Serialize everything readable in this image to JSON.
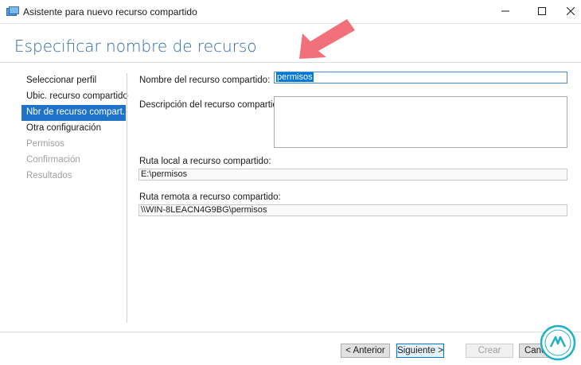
{
  "window": {
    "title": "Asistente para nuevo recurso compartido",
    "icon": "share-folder-icon"
  },
  "header": {
    "title": "Especificar nombre de recurso"
  },
  "nav": {
    "items": [
      {
        "label": "Seleccionar perfil",
        "state": "normal"
      },
      {
        "label": "Ubic. recurso compartido",
        "state": "normal"
      },
      {
        "label": "Nbr de recurso compart.",
        "state": "active"
      },
      {
        "label": "Otra configuración",
        "state": "normal"
      },
      {
        "label": "Permisos",
        "state": "disabled"
      },
      {
        "label": "Confirmación",
        "state": "disabled"
      },
      {
        "label": "Resultados",
        "state": "disabled"
      }
    ]
  },
  "form": {
    "share_name_label": "Nombre del recurso compartido:",
    "share_name_value": "permisos",
    "description_label": "Descripción del recurso compartido:",
    "description_value": "",
    "local_path_label": "Ruta local a recurso compartido:",
    "local_path_value": "E:\\permisos",
    "remote_path_label": "Ruta remota a recurso compartido:",
    "remote_path_value": "\\\\WIN-8LEACN4G9BG\\permisos"
  },
  "buttons": {
    "previous": "< Anterior",
    "next": "Siguiente >",
    "create": "Crear",
    "cancel": "Cancelar"
  },
  "colors": {
    "accent": "#1e73c9",
    "title_blue": "#2d6aa3",
    "arrow": "#f2707a",
    "logo_ring": "#1db0c6"
  }
}
